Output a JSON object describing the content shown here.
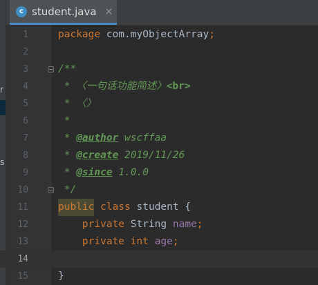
{
  "editor": {
    "tab": {
      "icon_letter": "c",
      "icon": "java-class-icon",
      "filename": "student.java",
      "close": "×"
    },
    "left_panel_fragments": [
      "r",
      "s"
    ],
    "current_line": 14,
    "lines": [
      {
        "n": "1",
        "tokens": [
          [
            "kw",
            "package "
          ],
          [
            "pl",
            "com.myObjectArray"
          ],
          [
            "kw",
            ";"
          ]
        ]
      },
      {
        "n": "2",
        "tokens": []
      },
      {
        "n": "3",
        "tokens": [
          [
            "cm",
            "/**"
          ]
        ]
      },
      {
        "n": "4",
        "tokens": [
          [
            "cm",
            " * 〈一句话功能简述〉"
          ],
          [
            "html-tag",
            "<br>"
          ]
        ]
      },
      {
        "n": "5",
        "tokens": [
          [
            "cm",
            " * 〈〉"
          ]
        ]
      },
      {
        "n": "6",
        "tokens": [
          [
            "cm",
            " *"
          ]
        ]
      },
      {
        "n": "7",
        "tokens": [
          [
            "cm",
            " * "
          ],
          [
            "tag",
            "@author"
          ],
          [
            "cm",
            " wscffaa"
          ]
        ]
      },
      {
        "n": "8",
        "tokens": [
          [
            "cm",
            " * "
          ],
          [
            "tag",
            "@create"
          ],
          [
            "cm",
            " 2019/11/26"
          ]
        ]
      },
      {
        "n": "9",
        "tokens": [
          [
            "cm",
            " * "
          ],
          [
            "tag",
            "@since"
          ],
          [
            "cm",
            " 1.0.0"
          ]
        ]
      },
      {
        "n": "10",
        "tokens": [
          [
            "cm",
            " */"
          ]
        ]
      },
      {
        "n": "11",
        "tokens": [
          [
            "kw-hl",
            "public"
          ],
          [
            "kw",
            " class "
          ],
          [
            "pl",
            "student {"
          ]
        ]
      },
      {
        "n": "12",
        "tokens": [
          [
            "kw",
            "    private "
          ],
          [
            "pl",
            "String "
          ],
          [
            "fld",
            "name"
          ],
          [
            "kw",
            ";"
          ]
        ]
      },
      {
        "n": "13",
        "tokens": [
          [
            "kw",
            "    private int "
          ],
          [
            "fld",
            "age"
          ],
          [
            "kw",
            ";"
          ]
        ]
      },
      {
        "n": "14",
        "tokens": []
      },
      {
        "n": "15",
        "tokens": [
          [
            "pl",
            "}"
          ]
        ]
      }
    ]
  }
}
